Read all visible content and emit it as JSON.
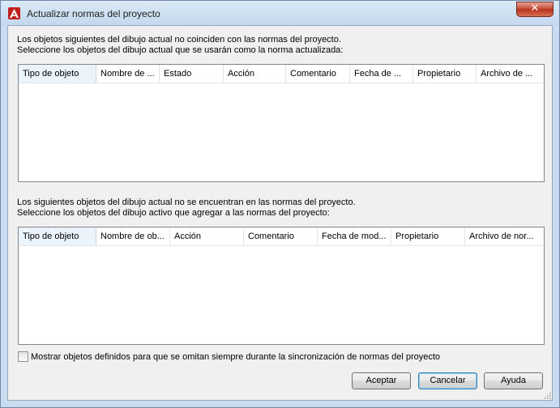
{
  "window": {
    "title": "Actualizar normas del proyecto",
    "close_glyph": "✕"
  },
  "section1": {
    "line1": "Los objetos siguientes del dibujo actual no coinciden con las normas del proyecto.",
    "line2": "Seleccione los objetos del dibujo actual que se usarán como la norma actualizada:",
    "columns": [
      "Tipo de objeto",
      "Nombre de ...",
      "Estado",
      "Acción",
      "Comentario",
      "Fecha de ...",
      "Propietario",
      "Archivo de ..."
    ],
    "rows": []
  },
  "section2": {
    "line1": "Los siguientes objetos del dibujo actual no se encuentran en las normas del proyecto.",
    "line2": "Seleccione los objetos del dibujo activo que agregar a las normas del proyecto:",
    "columns": [
      "Tipo de objeto",
      "Nombre de ob...",
      "Acción",
      "Comentario",
      "Fecha de mod...",
      "Propietario",
      "Archivo de nor..."
    ],
    "rows": []
  },
  "options": {
    "show_omitted_label": "Mostrar objetos definidos para que se omitan siempre durante la sincronización de normas del proyecto",
    "show_omitted_checked": false
  },
  "buttons": {
    "ok": "Aceptar",
    "cancel": "Cancelar",
    "help": "Ayuda"
  },
  "colors": {
    "accent": "#c7513c",
    "titlebar": "#c9dcef",
    "sorted_header": "#ecf4fb"
  },
  "icons": {
    "app": "autocad-logo-icon",
    "sort": "sort-ascending-icon"
  }
}
